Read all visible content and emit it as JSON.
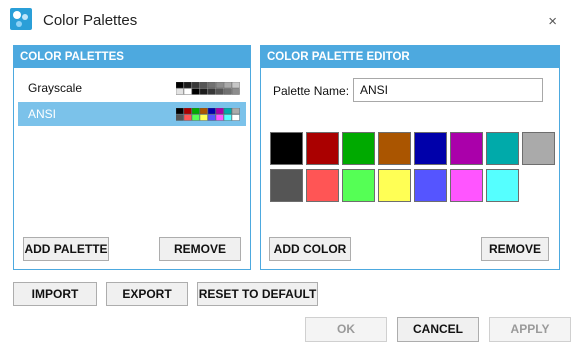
{
  "window": {
    "title": "Color Palettes",
    "close_glyph": "×",
    "app_icon": "palette-app-icon"
  },
  "palettes_panel": {
    "header": "COLOR PALETTES",
    "items": [
      {
        "label": "Grayscale",
        "selected": false,
        "swatches": [
          "#000000",
          "#1c1c1c",
          "#383838",
          "#555555",
          "#717171",
          "#8d8d8d",
          "#aaaaaa",
          "#c6c6c6",
          "#e2e2e2",
          "#ffffff",
          "#000000",
          "#1c1c1c",
          "#383838",
          "#555555",
          "#717171",
          "#8d8d8d"
        ]
      },
      {
        "label": "ANSI",
        "selected": true,
        "swatches": [
          "#000000",
          "#aa0000",
          "#00aa00",
          "#aa5500",
          "#0000aa",
          "#aa00aa",
          "#00aaaa",
          "#aaaaaa",
          "#555555",
          "#ff5555",
          "#55ff55",
          "#ffff55",
          "#5555ff",
          "#ff55ff",
          "#55ffff",
          "#ffffff"
        ]
      }
    ],
    "add_label": "ADD PALETTE",
    "remove_label": "REMOVE"
  },
  "editor_panel": {
    "header": "COLOR PALETTE EDITOR",
    "name_label": "Palette Name:",
    "name_value": "ANSI",
    "colors": [
      "#000000",
      "#aa0000",
      "#00aa00",
      "#aa5500",
      "#0000aa",
      "#aa00aa",
      "#00aaaa",
      "#aaaaaa",
      "#555555",
      "#ff5555",
      "#55ff55",
      "#ffff55",
      "#5555ff",
      "#ff55ff",
      "#55ffff"
    ],
    "add_label": "ADD COLOR",
    "remove_label": "REMOVE"
  },
  "bottom": {
    "import_label": "IMPORT",
    "export_label": "EXPORT",
    "reset_label": "RESET TO DEFAULT",
    "ok_label": "OK",
    "cancel_label": "CANCEL",
    "apply_label": "APPLY"
  },
  "accent_color": "#4da9df",
  "selection_color": "#7bc2ea"
}
